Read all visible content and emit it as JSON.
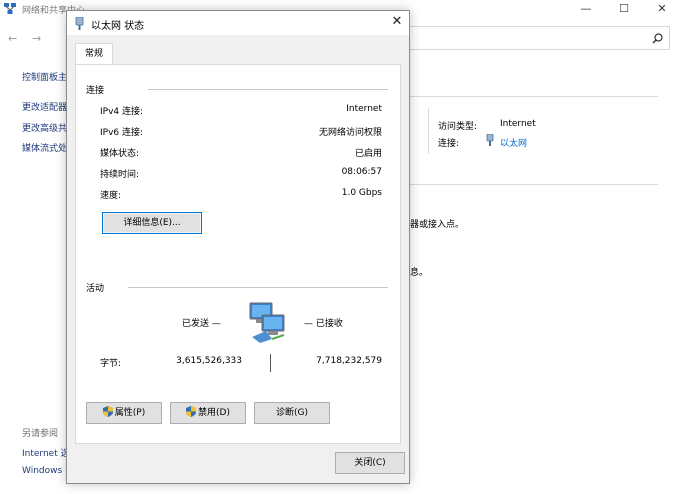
{
  "background_window": {
    "title": "网络和共享中心",
    "nav_back": "←",
    "nav_forward": "→",
    "sidebar": {
      "control_panel_home": "控制面板主",
      "change_adapter": "更改适配器",
      "change_advanced": "更改高级共",
      "media_streaming": "媒体流式处",
      "see_also": "另请参阅",
      "internet_options": "Internet 选",
      "windows_firewall": "Windows"
    },
    "network": {
      "access_type_label": "访问类型:",
      "access_type_value": "Internet",
      "connections_label": "连接:",
      "connections_value": "以太网"
    },
    "truncated_text_1": "器或接入点。",
    "truncated_text_2": "息。"
  },
  "dialog": {
    "title": "以太网 状态",
    "tab_general": "常规",
    "connection": {
      "heading": "连接",
      "rows": [
        {
          "label": "IPv4 连接:",
          "value": "Internet"
        },
        {
          "label": "IPv6 连接:",
          "value": "无网络访问权限"
        },
        {
          "label": "媒体状态:",
          "value": "已启用"
        },
        {
          "label": "持续时间:",
          "value": "08:06:57"
        },
        {
          "label": "速度:",
          "value": "1.0 Gbps"
        }
      ],
      "details_button": "详细信息(E)..."
    },
    "activity": {
      "heading": "活动",
      "sent_label": "已发送 —",
      "received_label": "— 已接收",
      "bytes_label": "字节:",
      "bytes_sent": "3,615,526,333",
      "bytes_received": "7,718,232,579"
    },
    "buttons": {
      "properties": "属性(P)",
      "disable": "禁用(D)",
      "diagnose": "诊断(G)",
      "close": "关闭(C)"
    }
  }
}
